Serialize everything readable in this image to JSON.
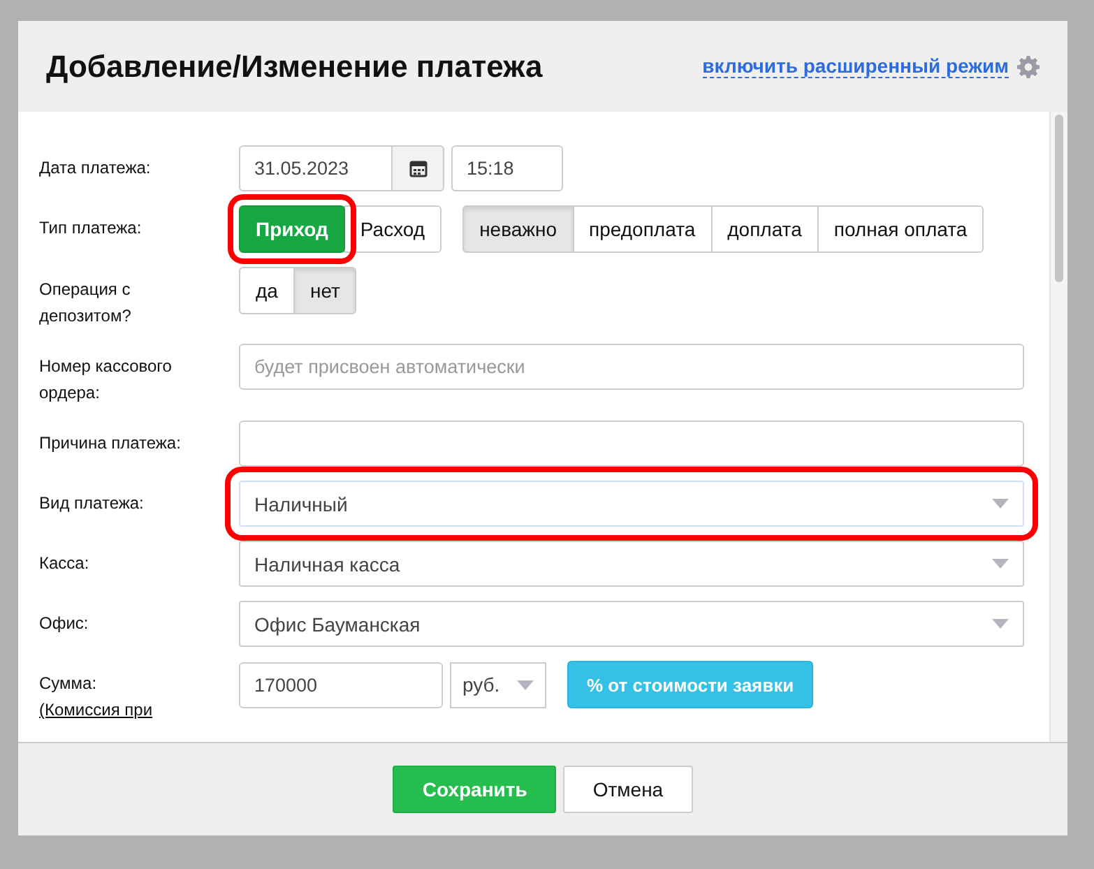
{
  "dialog": {
    "title": "Добавление/Изменение платежа",
    "advanced_link": "включить расширенный режим",
    "fields": [
      {
        "kind": "datetime",
        "label": "Дата платежа:",
        "date": "31.05.2023",
        "time": "15:18"
      },
      {
        "kind": "choices",
        "label": "Тип платежа:",
        "groups": [
          {
            "kind": "success",
            "options": [
              {
                "label": "Приход",
                "selected": true,
                "highlighted": true
              },
              {
                "label": "Расход",
                "selected": false,
                "highlighted": false
              }
            ]
          },
          {
            "kind": "default",
            "options": [
              {
                "label": "неважно",
                "selected": true,
                "highlighted": false
              },
              {
                "label": "предоплата",
                "selected": false,
                "highlighted": false
              },
              {
                "label": "доплата",
                "selected": false,
                "highlighted": false
              },
              {
                "label": "полная оплата",
                "selected": false,
                "highlighted": false
              }
            ]
          }
        ]
      },
      {
        "kind": "choices",
        "label": "Операция с депозитом?",
        "groups": [
          {
            "kind": "default",
            "options": [
              {
                "label": "да",
                "selected": false,
                "highlighted": false
              },
              {
                "label": "нет",
                "selected": true,
                "highlighted": false
              }
            ]
          }
        ]
      },
      {
        "kind": "text",
        "label": "Номер кассового ордера:",
        "placeholder": "будет присвоен автоматически"
      },
      {
        "kind": "text",
        "label": "Причина платежа:"
      },
      {
        "kind": "select",
        "label": "Вид платежа:",
        "value": "Наличный",
        "highlighted": true
      },
      {
        "kind": "select",
        "label": "Касса:",
        "value": "Наличная касса",
        "highlighted": false
      },
      {
        "kind": "select",
        "label": "Офис:",
        "value": "Офис Бауманская",
        "highlighted": false
      },
      {
        "kind": "amount",
        "label": "Сумма:",
        "note": "(Комиссия при",
        "value": "170000",
        "currency": "руб.",
        "action": "% от стоимости заявки"
      }
    ],
    "buttons": [
      {
        "label": "Сохранить",
        "kind": "primary"
      },
      {
        "label": "Отмена",
        "kind": "default"
      }
    ]
  }
}
